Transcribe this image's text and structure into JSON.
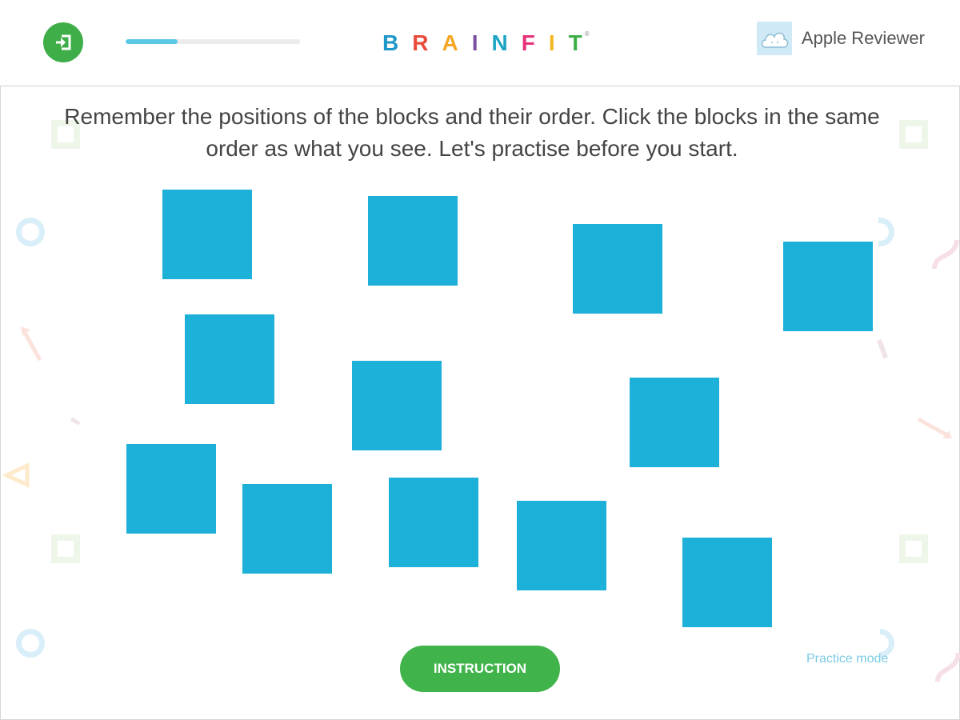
{
  "header": {
    "exit_icon": "exit-icon",
    "progress": 0.3,
    "logo_letters": [
      {
        "char": "B",
        "color": "#1f97c9"
      },
      {
        "char": "R",
        "color": "#e94b3c"
      },
      {
        "char": "A",
        "color": "#f5a623"
      },
      {
        "char": "I",
        "color": "#7b4fa0"
      },
      {
        "char": "N",
        "color": "#1fa4c8"
      },
      {
        "char": "F",
        "color": "#e5327a"
      },
      {
        "char": "I",
        "color": "#f3b61f"
      },
      {
        "char": "T",
        "color": "#3fae49"
      }
    ],
    "logo_reg": "®",
    "user_icon": "cloud-avatar-icon",
    "user_name": "Apple Reviewer"
  },
  "instructions": "Remember the positions of the blocks and their order. Click the blocks in the same order as what you see. Let's practise before you start.",
  "game": {
    "block_count": 12,
    "block_color": "#1db0d9"
  },
  "footer": {
    "instruction_button": "INSTRUCTION",
    "practice_mode": "Practice mode"
  },
  "colors": {
    "accent_green": "#40b34a",
    "progress_blue": "#5bc8e8"
  }
}
